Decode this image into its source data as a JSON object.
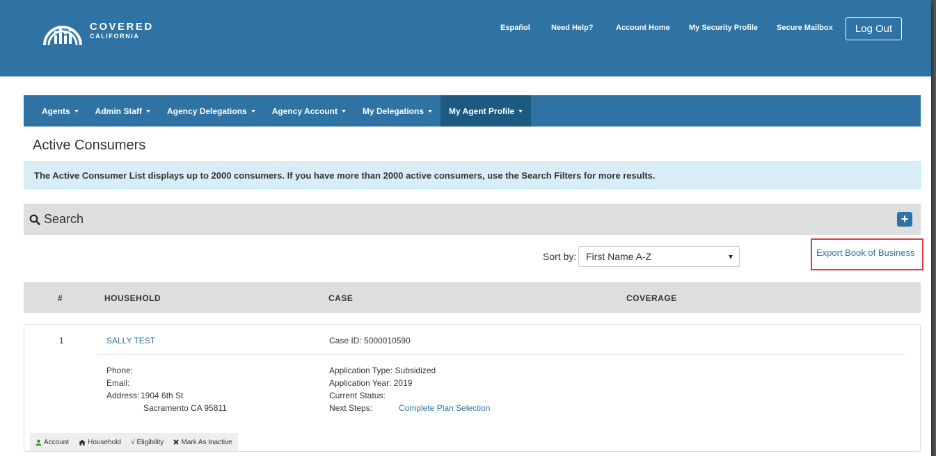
{
  "header": {
    "brand_line1": "COVERED",
    "brand_line2": "CALIFORNIA",
    "links": [
      "Español",
      "Need Help?",
      "Account Home",
      "My Security Profile",
      "Secure Mailbox"
    ],
    "logout_label": "Log Out"
  },
  "nav": {
    "items": [
      "Agents",
      "Admin Staff",
      "Agency Delegations",
      "Agency Account",
      "My Delegations",
      "My Agent Profile"
    ],
    "active_index": 5
  },
  "page": {
    "title": "Active Consumers",
    "info_message": "The Active Consumer List displays up to 2000 consumers. If you have more than 2000 active consumers, use the Search Filters for more results."
  },
  "search": {
    "label": "Search",
    "expand_icon": "plus-icon"
  },
  "sort": {
    "label": "Sort by:",
    "selected": "First Name A-Z"
  },
  "export_label": "Export Book of Business",
  "table": {
    "columns": [
      "#",
      "HOUSEHOLD",
      "CASE",
      "COVERAGE"
    ]
  },
  "consumers": [
    {
      "number": "1",
      "name": "SALLY TEST",
      "case_id_label": "Case ID:",
      "case_id": "5000010590",
      "phone_label": "Phone:",
      "email_label": "Email:",
      "address_label": "Address:",
      "address_line1": "1904 6th St",
      "address_line2": "Sacramento CA 95811",
      "app_type_label": "Application Type:",
      "app_type": "Subsidized",
      "app_year_label": "Application Year:",
      "app_year": "2019",
      "status_label": "Current Status:",
      "next_steps_label": "Next Steps:",
      "next_steps": "Complete Plan Selection",
      "actions": [
        "Account",
        "Household",
        "Eligibility",
        "Mark As Inactive"
      ]
    }
  ],
  "colors": {
    "brand_blue": "#2e73a3",
    "nav_active": "#1d5a82",
    "alert_bg": "#d9edf7",
    "highlight_red": "#e03a3e",
    "account_icon_green": "#3a8a3a"
  }
}
